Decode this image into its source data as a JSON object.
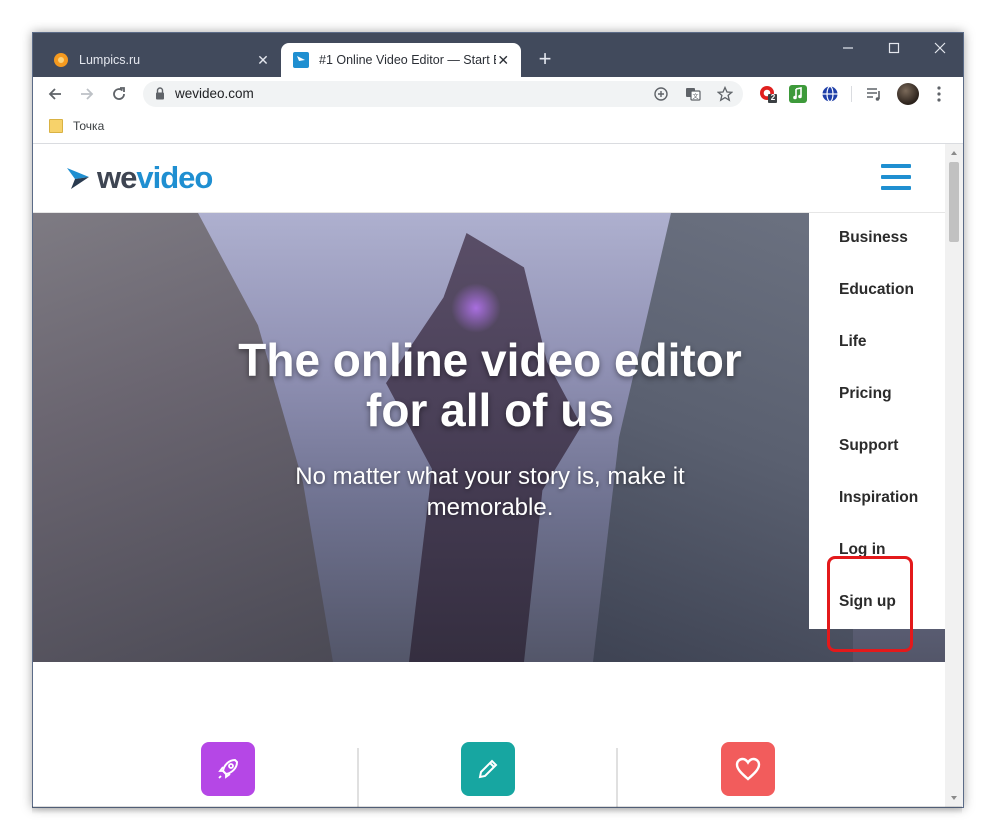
{
  "browser": {
    "tabs": [
      {
        "title": "Lumpics.ru",
        "active": false
      },
      {
        "title": "#1 Online Video Editor — Start E",
        "active": true
      }
    ],
    "new_tab": "+",
    "window_controls": {
      "minimize": "minimize",
      "maximize": "maximize",
      "close": "close"
    },
    "url": "wevideo.com",
    "bookmarks": [
      {
        "label": "Точка"
      }
    ],
    "extension_badge": "2"
  },
  "site": {
    "logo": {
      "we": "we",
      "video": "video"
    },
    "hero": {
      "title": "The online video editor for all of us",
      "subtitle": "No matter what your story is, make it memorable."
    },
    "menu": [
      "Business",
      "Education",
      "Life",
      "Pricing",
      "Support",
      "Inspiration",
      "Log in",
      "Sign up"
    ],
    "highlighted_items": [
      "Log in",
      "Sign up"
    ],
    "features": [
      {
        "icon": "rocket-icon",
        "color": "#b547e6"
      },
      {
        "icon": "pencil-icon",
        "color": "#17a6a1"
      },
      {
        "icon": "heart-icon",
        "color": "#f25c5c"
      }
    ]
  },
  "colors": {
    "titlebar": "#414a5c",
    "brand_blue": "#1f8fd1",
    "highlight_red": "#e3191b"
  }
}
